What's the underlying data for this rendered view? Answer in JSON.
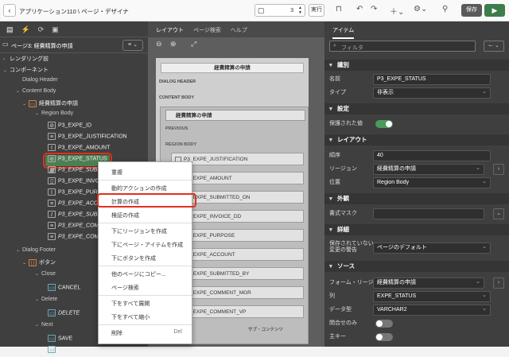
{
  "topbar": {
    "app_title": "アプリケーション110",
    "separator": "\\",
    "page_designer": "ページ・デザイナ",
    "page_number": "3",
    "run_label": "実行",
    "save_label": "保存"
  },
  "left": {
    "page_header": "ページ3: 経費精算の申請",
    "tree": {
      "rendering_before": "レンダリング前",
      "components": "コンポーネント",
      "dialog_header": "Dialog Header",
      "content_body": "Content Body",
      "region": "経費精算の申請",
      "region_body": "Region Body",
      "items": [
        "P3_EXPE_ID",
        "P3_EXPE_JUSTIFICATION",
        "P3_EXPE_AMOUNT",
        "P3_EXPE_STATUS",
        "P3_EXPE_SUBMITT",
        "P3_EXPE_INVOICE",
        "P3_EXPE_PURPO",
        "P3_EXPE_ACCOU",
        "P3_EXPE_SUBMITT",
        "P3_EXPE_COMME",
        "P3_EXPE_COMME"
      ],
      "dialog_footer": "Dialog Footer",
      "buttons": "ボタン",
      "close": "Close",
      "cancel": "CANCEL",
      "delete_group": "Delete",
      "delete_btn": "DELETE",
      "next": "Next",
      "save": "SAVE",
      "create": "CREATE"
    }
  },
  "mid": {
    "tabs": [
      "レイアウト",
      "ページ検索",
      "ヘルプ"
    ],
    "canvas_title": "経費精算の申請",
    "dialog_header": "DIALOG HEADER",
    "content_body": "CONTENT BODY",
    "region_title": "経費精算の申請",
    "previous": "PREVIOUS",
    "region_body": "REGION BODY",
    "items": [
      "P3_EXPE_JUSTIFICATION",
      "P3_EXPE_AMOUNT",
      "P3_EXPE_SUBMITTED_ON",
      "P3_EXPE_INVOICE_DD",
      "P3_EXPE_PURPOSE",
      "P3_EXPE_ACCOUNT",
      "P3_EXPE_SUBMITTED_BY",
      "P3_EXPE_COMMENT_MGR",
      "P3_EXPE_COMMENT_VP"
    ],
    "sub_contents": "サブ・コンテンツ"
  },
  "context_menu": {
    "items": {
      "duplicate": "重複",
      "create_dynamic_action": "動的アクションの作成",
      "create_computation": "計算の作成",
      "create_validation": "検証の作成",
      "create_region_below": "下にリージョンを作成",
      "create_page_item_below": "下にページ・アイテムを作成",
      "create_button_below": "下にボタンを作成",
      "copy_to_other_page": "他のページにコピー...",
      "page_search": "ページ検索",
      "expand_all_below": "下をすべて展開",
      "collapse_all_below": "下をすべて縮小",
      "delete": "削除",
      "delete_key": "Del"
    }
  },
  "right": {
    "tab": "アイテム",
    "filter_placeholder": "フィルタ",
    "sections": {
      "identification": "識別",
      "settings": "設定",
      "layout": "レイアウト",
      "appearance": "外観",
      "advanced": "詳細",
      "source": "ソース"
    },
    "fields": {
      "name_label": "名前",
      "name_value": "P3_EXPE_STATUS",
      "type_label": "タイプ",
      "type_value": "非表示",
      "protected_label": "保護された値",
      "sequence_label": "順序",
      "sequence_value": "40",
      "region_label": "リージョン",
      "region_value": "経費精算の申請",
      "position_label": "位置",
      "position_value": "Region Body",
      "format_mask_label": "書式マスク",
      "warn_label_1": "保存されていない",
      "warn_label_2": "変更の警告",
      "warn_value": "ページのデフォルト",
      "form_region_label": "フォーム・リージョン",
      "form_region_value": "経費精算の申請",
      "column_label": "列",
      "column_value": "EXPE_STATUS",
      "data_type_label": "データ型",
      "data_type_value": "VARCHAR2",
      "query_only_label": "問合せのみ",
      "primary_key_label": "主キー"
    }
  },
  "colors": {
    "accent_green": "#4d7f52",
    "highlight_red": "#e1301e"
  }
}
